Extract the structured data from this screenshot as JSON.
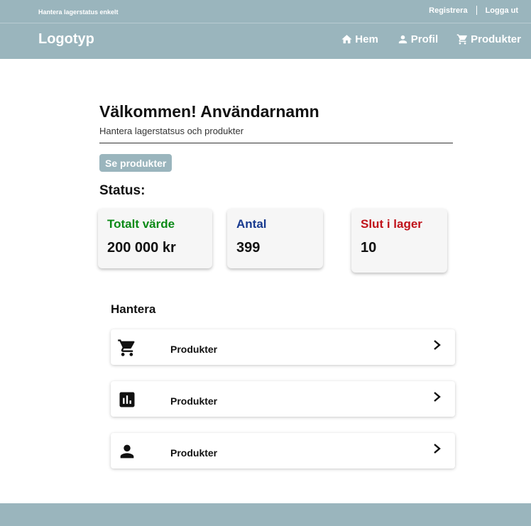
{
  "topbar": {
    "tagline": "Hantera lagerstatus enkelt",
    "register": "Registrera",
    "logout": "Logga ut"
  },
  "navbar": {
    "logo": "Logotyp",
    "items": [
      {
        "label": "Hem",
        "icon": "home-icon"
      },
      {
        "label": "Profil",
        "icon": "person-icon"
      },
      {
        "label": "Produkter",
        "icon": "cart-icon"
      }
    ]
  },
  "main": {
    "welcome": "Välkommen! Användarnamn",
    "subtitle": "Hantera lagerstatsus och produkter",
    "button": "Se produkter",
    "status_title": "Status:",
    "cards": [
      {
        "label": "Totalt värde",
        "value": "200 000 kr",
        "color": "#0b8a16"
      },
      {
        "label": "Antal",
        "value": "399",
        "color": "#183a8f"
      },
      {
        "label": "Slut i lager",
        "value": "10",
        "color": "#c0121a"
      }
    ],
    "manage_title": "Hantera",
    "manage_rows": [
      {
        "label": "Produkter",
        "icon": "cart-icon"
      },
      {
        "label": "Produkter",
        "icon": "bar-chart-icon"
      },
      {
        "label": "Produkter",
        "icon": "person-icon"
      }
    ]
  },
  "colors": {
    "header_bg": "#9ab5bd",
    "accent": "#9ab5bd"
  }
}
